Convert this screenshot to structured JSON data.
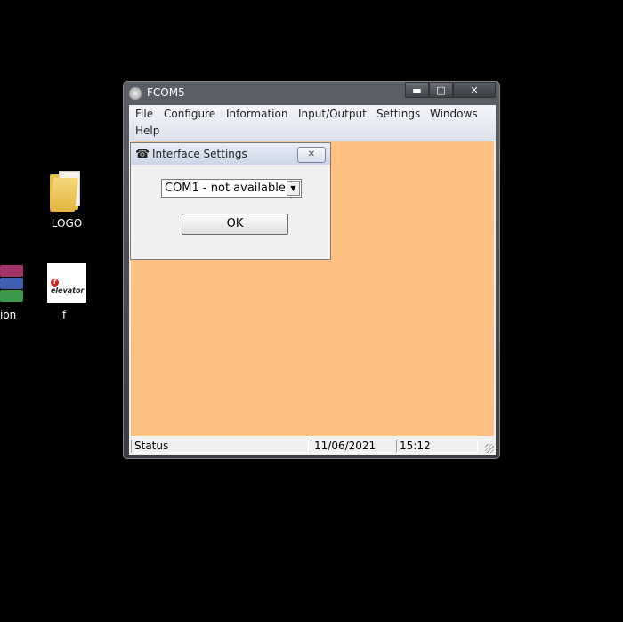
{
  "desktop": {
    "icons": [
      {
        "label": "LOGO"
      },
      {
        "label": "ion"
      },
      {
        "label": "f"
      }
    ],
    "app_icon_text": "elevator",
    "app_icon_mark": "f"
  },
  "window": {
    "title": "FCOM5",
    "buttons": {
      "minimize": "▬",
      "maximize": "□",
      "close": "✕"
    },
    "menu": [
      "File",
      "Configure",
      "Information",
      "Input/Output",
      "Settings",
      "Windows",
      "Help"
    ],
    "status": {
      "text": "Status",
      "date": "11/06/2021",
      "time": "15:12"
    }
  },
  "dialog": {
    "title": "Interface Settings",
    "close": "✕",
    "combo_value": "COM1 - not available",
    "combo_arrow": "▼",
    "ok_label": "OK"
  },
  "colors": {
    "mdi_background": "#ffc081",
    "desktop": "#000000"
  }
}
